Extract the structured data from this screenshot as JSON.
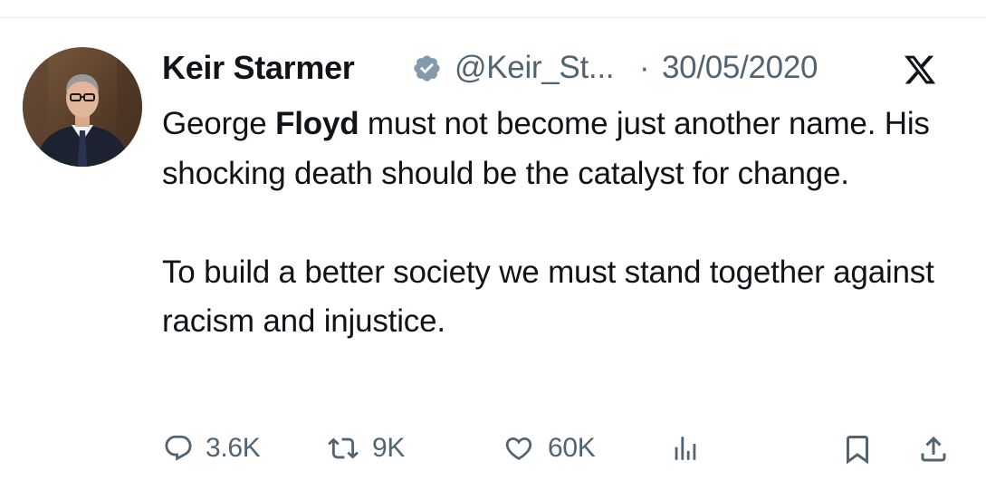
{
  "tweet": {
    "author": {
      "display_name": "Keir Starmer",
      "handle": "@Keir_St...",
      "verified": true,
      "avatar_icon": "profile-photo"
    },
    "separator": "·",
    "date": "30/05/2020",
    "platform_icon": "x-logo-icon",
    "body": {
      "paragraph_1": {
        "part_1": "George ",
        "part_bold": "Floyd",
        "part_2": " must not become just another name. His shocking death should be the catalyst for change."
      },
      "paragraph_2": "To build a better society we must stand together against racism and injustice."
    },
    "actions": {
      "replies": {
        "icon": "reply-icon",
        "count": "3.6K"
      },
      "reposts": {
        "icon": "repost-icon",
        "count": "9K"
      },
      "likes": {
        "icon": "like-icon",
        "count": "60K"
      },
      "views": {
        "icon": "views-icon"
      },
      "bookmark": {
        "icon": "bookmark-icon"
      },
      "share": {
        "icon": "share-icon"
      }
    }
  },
  "colors": {
    "text_primary": "#0f1419",
    "text_secondary": "#536471",
    "divider": "#e7e9ea",
    "verified_badge": "#829aab"
  }
}
